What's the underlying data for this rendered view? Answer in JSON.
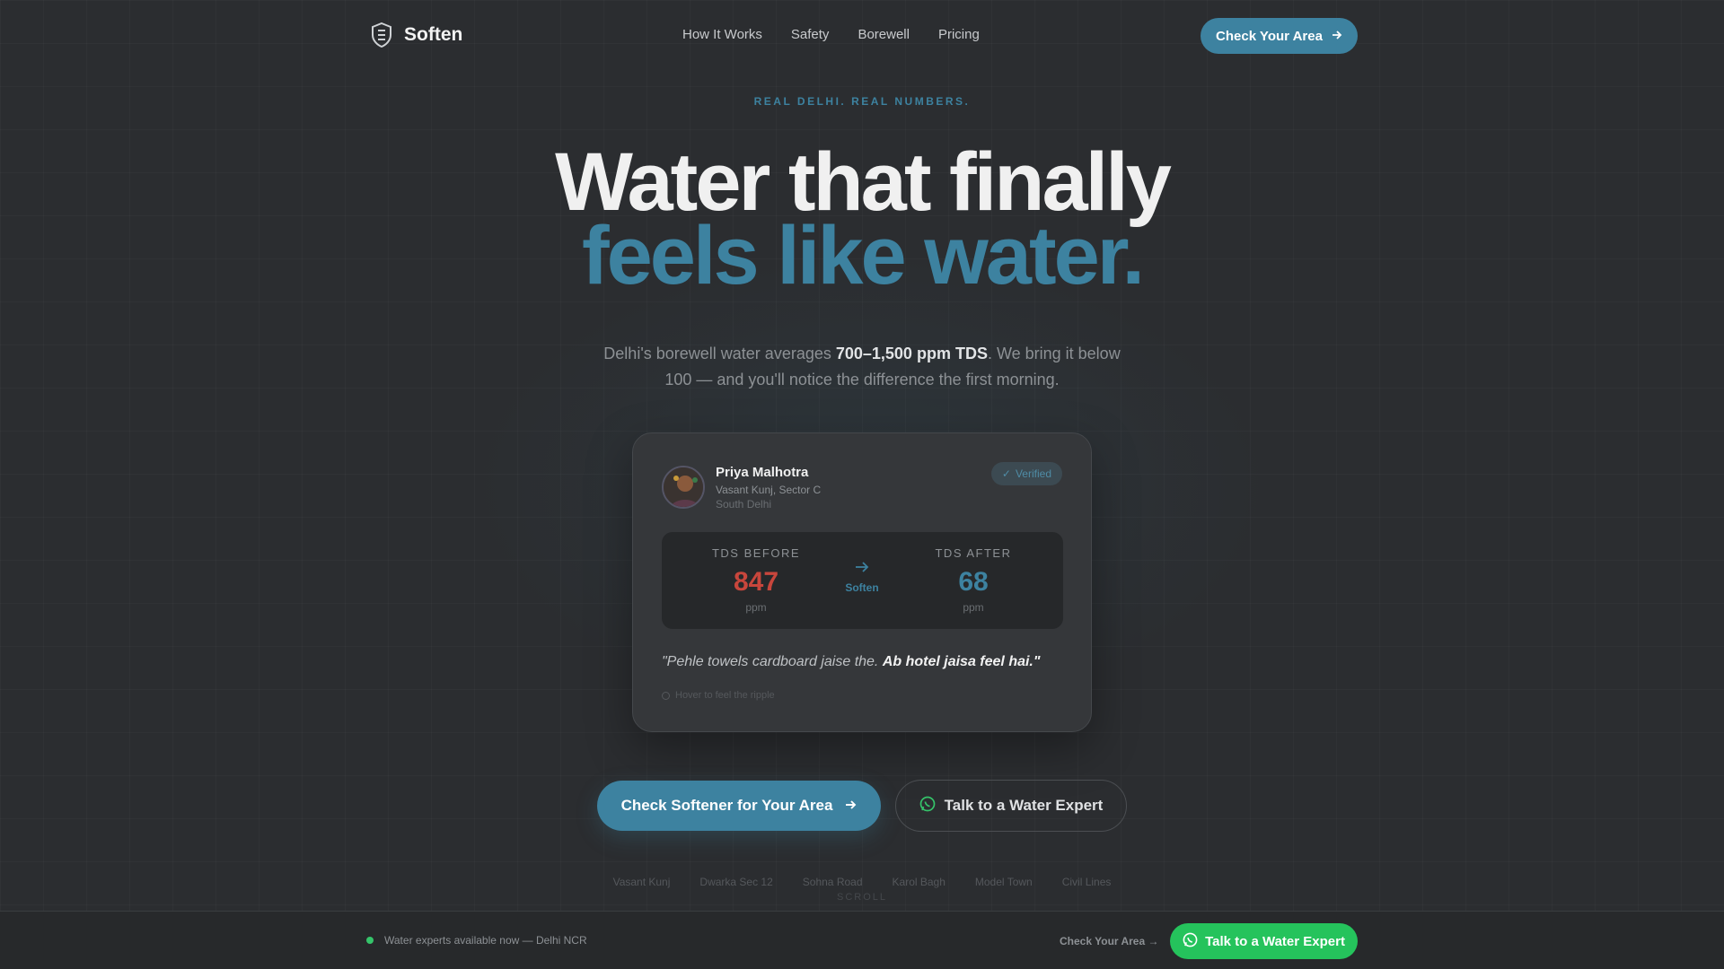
{
  "brand": {
    "name": "Soften"
  },
  "nav": {
    "links": [
      "How It Works",
      "Safety",
      "Borewell",
      "Pricing"
    ],
    "cta": "Check Your Area"
  },
  "hero": {
    "eyebrow": "REAL DELHI. REAL NUMBERS.",
    "title_line1": "Water that finally",
    "title_line2": "feels like water.",
    "sub_pre": "Delhi's borewell water averages ",
    "sub_bold": "700–1,500 ppm TDS",
    "sub_post": ". We bring it below 100 — and you'll notice the difference the first morning."
  },
  "testimonial": {
    "name": "Priya Malhotra",
    "location": "Vasant Kunj, Sector C",
    "area": "South Delhi",
    "badge": "Verified",
    "tds_before_label": "TDS BEFORE",
    "tds_before": "847",
    "tds_after_label": "TDS AFTER",
    "tds_after": "68",
    "unit": "ppm",
    "mid_label": "Soften",
    "quote_pre": "\"Pehle towels cardboard jaise the. ",
    "quote_bold": "Ab hotel jaisa feel hai.\"",
    "hint": "Hover to feel the ripple"
  },
  "ctas": {
    "primary": "Check Softener for Your Area",
    "secondary": "Talk to a Water Expert"
  },
  "areas": [
    "Vasant Kunj",
    "Dwarka Sec 12",
    "Sohna Road",
    "Karol Bagh",
    "Model Town",
    "Civil Lines"
  ],
  "scroll": "SCROLL",
  "bottom_bar": {
    "status": "Water experts available now — Delhi NCR",
    "link": "Check Your Area →",
    "whatsapp": "Talk to a Water Expert"
  },
  "colors": {
    "accent": "#3d82a0",
    "danger": "#c8463c",
    "whatsapp": "#25c35c",
    "background": "#2b2d30"
  },
  "icons": [
    "shield-logo-icon",
    "arrow-right-icon",
    "check-icon",
    "whatsapp-icon"
  ]
}
